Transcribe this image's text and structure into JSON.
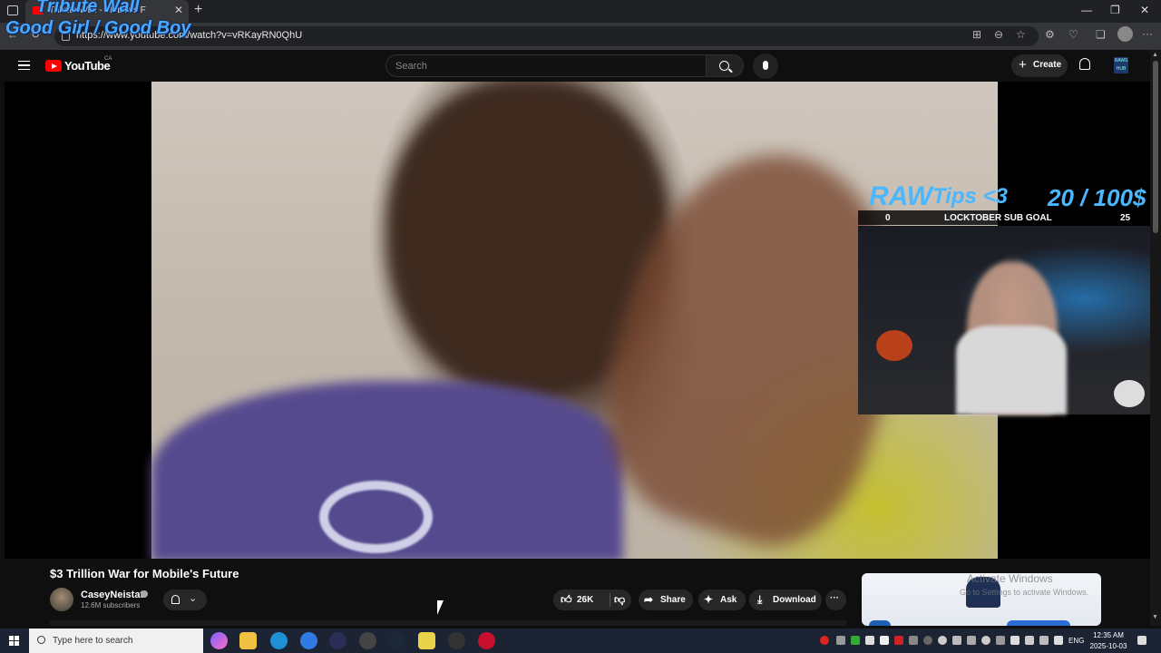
{
  "browser": {
    "tab_title": "Tribute Wall - Mobile's F",
    "url": "https://www.youtube.com/watch?v=vRKayRN0QhU",
    "new_tab_symbol": "+",
    "close_symbol": "✕"
  },
  "overlay": {
    "line1": "Tribute Wall",
    "line2": "Good Girl / Good Boy",
    "raw": "RAW",
    "tips_label": "Tips <3",
    "tips_amount": "20 / 100$",
    "goal_start": "0",
    "goal_label": "LOCKTOBER SUB GOAL",
    "goal_end": "25"
  },
  "youtube": {
    "logo_text": "YouTube",
    "country": "CA",
    "search_placeholder": "Search",
    "create_label": "Create",
    "avatar_text": "RAWS HUB"
  },
  "video": {
    "title": "$3 Trillion War for Mobile's Future",
    "channel": "CaseyNeistat",
    "subscribers": "12.6M subscribers",
    "likes": "26K",
    "share_label": "Share",
    "ask_label": "Ask",
    "download_label": "Download",
    "more_label": "···"
  },
  "watermark": {
    "line1": "Activate Windows",
    "line2": "Go to Settings to activate Windows."
  },
  "taskbar": {
    "search_placeholder": "Type here to search",
    "language": "ENG",
    "time": "12:35 AM",
    "date": "2025-10-03"
  },
  "colors": {
    "youtube_red": "#ff0000",
    "overlay_blue": "#4ab7ff",
    "background": "#0f0f0f"
  }
}
